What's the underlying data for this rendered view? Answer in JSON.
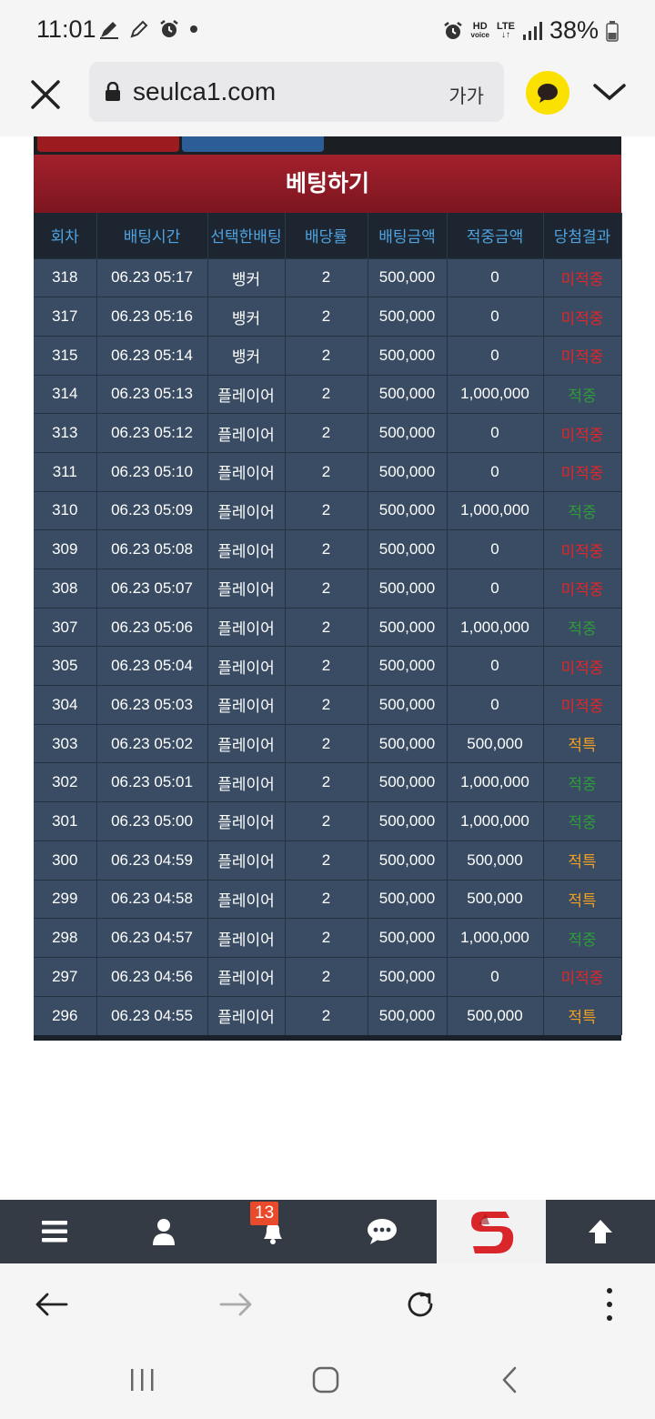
{
  "status_bar": {
    "time": "11:01",
    "hd_label": "HD",
    "voice_label": "voice",
    "lte_label": "LTE",
    "battery_percent": "38%"
  },
  "address_bar": {
    "url": "seulca1.com",
    "font_size_label": "가가"
  },
  "page": {
    "title": "베팅하기"
  },
  "table": {
    "headers": [
      "회차",
      "배팅시간",
      "선택한배팅",
      "배당률",
      "배팅금액",
      "적중금액",
      "당첨결과"
    ],
    "rows": [
      {
        "round": "318",
        "time": "06.23 05:17",
        "pick": "뱅커",
        "odds": "2",
        "bet": "500,000",
        "win": "0",
        "result": "미적중",
        "status": "lose"
      },
      {
        "round": "317",
        "time": "06.23 05:16",
        "pick": "뱅커",
        "odds": "2",
        "bet": "500,000",
        "win": "0",
        "result": "미적중",
        "status": "lose"
      },
      {
        "round": "315",
        "time": "06.23 05:14",
        "pick": "뱅커",
        "odds": "2",
        "bet": "500,000",
        "win": "0",
        "result": "미적중",
        "status": "lose"
      },
      {
        "round": "314",
        "time": "06.23 05:13",
        "pick": "플레이어",
        "odds": "2",
        "bet": "500,000",
        "win": "1,000,000",
        "result": "적중",
        "status": "win"
      },
      {
        "round": "313",
        "time": "06.23 05:12",
        "pick": "플레이어",
        "odds": "2",
        "bet": "500,000",
        "win": "0",
        "result": "미적중",
        "status": "lose"
      },
      {
        "round": "311",
        "time": "06.23 05:10",
        "pick": "플레이어",
        "odds": "2",
        "bet": "500,000",
        "win": "0",
        "result": "미적중",
        "status": "lose"
      },
      {
        "round": "310",
        "time": "06.23 05:09",
        "pick": "플레이어",
        "odds": "2",
        "bet": "500,000",
        "win": "1,000,000",
        "result": "적중",
        "status": "win"
      },
      {
        "round": "309",
        "time": "06.23 05:08",
        "pick": "플레이어",
        "odds": "2",
        "bet": "500,000",
        "win": "0",
        "result": "미적중",
        "status": "lose"
      },
      {
        "round": "308",
        "time": "06.23 05:07",
        "pick": "플레이어",
        "odds": "2",
        "bet": "500,000",
        "win": "0",
        "result": "미적중",
        "status": "lose"
      },
      {
        "round": "307",
        "time": "06.23 05:06",
        "pick": "플레이어",
        "odds": "2",
        "bet": "500,000",
        "win": "1,000,000",
        "result": "적중",
        "status": "win"
      },
      {
        "round": "305",
        "time": "06.23 05:04",
        "pick": "플레이어",
        "odds": "2",
        "bet": "500,000",
        "win": "0",
        "result": "미적중",
        "status": "lose"
      },
      {
        "round": "304",
        "time": "06.23 05:03",
        "pick": "플레이어",
        "odds": "2",
        "bet": "500,000",
        "win": "0",
        "result": "미적중",
        "status": "lose"
      },
      {
        "round": "303",
        "time": "06.23 05:02",
        "pick": "플레이어",
        "odds": "2",
        "bet": "500,000",
        "win": "500,000",
        "result": "적특",
        "status": "tie"
      },
      {
        "round": "302",
        "time": "06.23 05:01",
        "pick": "플레이어",
        "odds": "2",
        "bet": "500,000",
        "win": "1,000,000",
        "result": "적중",
        "status": "win"
      },
      {
        "round": "301",
        "time": "06.23 05:00",
        "pick": "플레이어",
        "odds": "2",
        "bet": "500,000",
        "win": "1,000,000",
        "result": "적중",
        "status": "win"
      },
      {
        "round": "300",
        "time": "06.23 04:59",
        "pick": "플레이어",
        "odds": "2",
        "bet": "500,000",
        "win": "500,000",
        "result": "적특",
        "status": "tie"
      },
      {
        "round": "299",
        "time": "06.23 04:58",
        "pick": "플레이어",
        "odds": "2",
        "bet": "500,000",
        "win": "500,000",
        "result": "적특",
        "status": "tie"
      },
      {
        "round": "298",
        "time": "06.23 04:57",
        "pick": "플레이어",
        "odds": "2",
        "bet": "500,000",
        "win": "1,000,000",
        "result": "적중",
        "status": "win"
      },
      {
        "round": "297",
        "time": "06.23 04:56",
        "pick": "플레이어",
        "odds": "2",
        "bet": "500,000",
        "win": "0",
        "result": "미적중",
        "status": "lose"
      },
      {
        "round": "296",
        "time": "06.23 04:55",
        "pick": "플레이어",
        "odds": "2",
        "bet": "500,000",
        "win": "500,000",
        "result": "적특",
        "status": "tie"
      }
    ]
  },
  "site_toolbar": {
    "notification_count": "13",
    "icons": [
      "hamburger-menu-icon",
      "user-icon",
      "bell-icon",
      "chat-bubble-icon",
      "site-logo",
      "arrow-up-icon"
    ]
  },
  "colors": {
    "result_lose": "#e0262a",
    "result_win": "#2e9c3c",
    "result_tie": "#f0a020",
    "title_bar": "#8d1a24",
    "table_row": "#3a4c63",
    "header_text": "#4fa3e0"
  }
}
